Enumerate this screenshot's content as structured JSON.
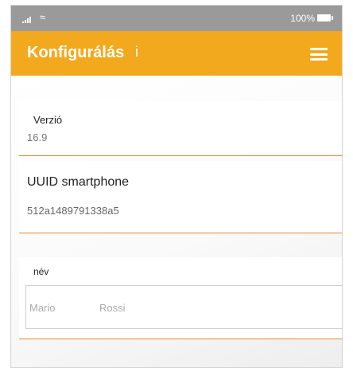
{
  "status_bar": {
    "battery": "100%"
  },
  "app_bar": {
    "title": "Konfigurálás",
    "info": "i"
  },
  "fields": {
    "version": {
      "label": "Verzió",
      "value": "16.9"
    },
    "uuid": {
      "label": "UUID smartphone",
      "value": "512a1489791338a5"
    },
    "name": {
      "label": "név",
      "first": "Mario",
      "last": "Rossi"
    }
  },
  "colors": {
    "accent": "#f3a91d",
    "divider": "#e7892c",
    "status": "#9a9a9a"
  }
}
